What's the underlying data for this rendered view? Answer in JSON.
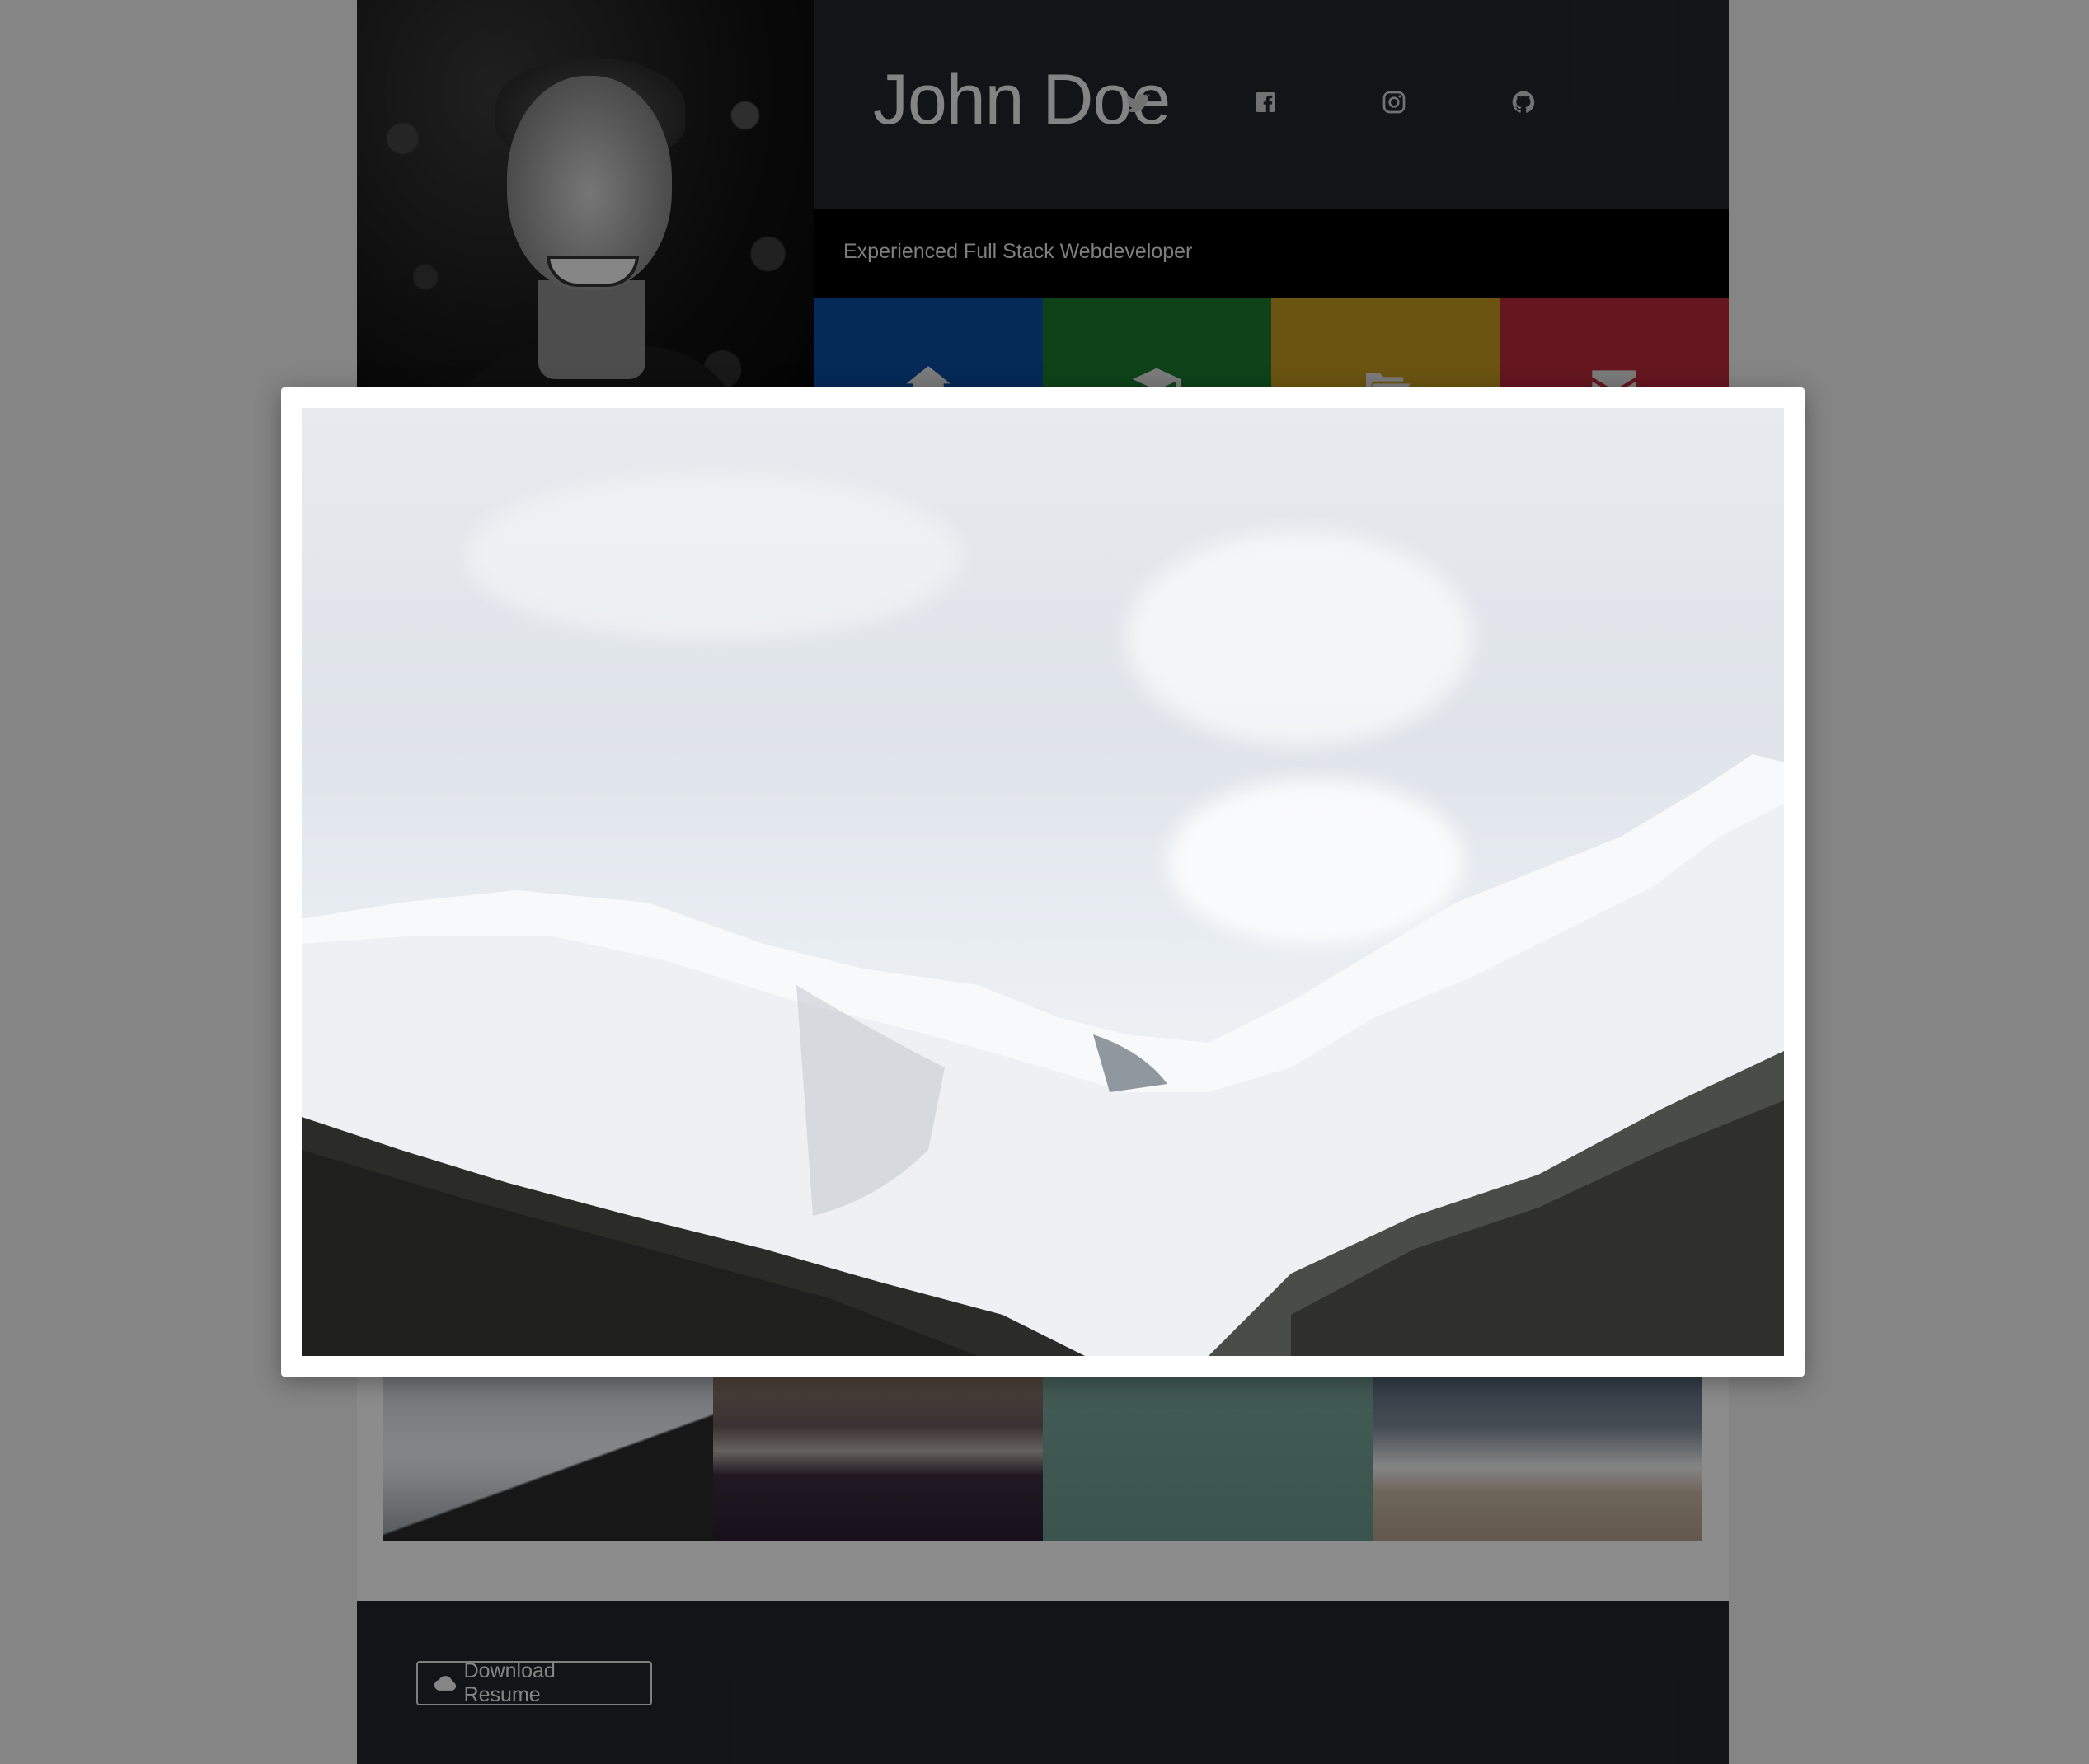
{
  "profile": {
    "name": "John Doe",
    "tagline": "Experienced Full Stack Webdeveloper"
  },
  "social": [
    "twitter-icon",
    "facebook-icon",
    "instagram-icon",
    "github-icon"
  ],
  "nav_tiles": [
    {
      "icon": "home-icon",
      "color": "#0a4ea1"
    },
    {
      "icon": "graduation-cap-icon",
      "color": "#1a7a2e"
    },
    {
      "icon": "folder-open-icon",
      "color": "#c49a1f"
    },
    {
      "icon": "envelope-icon",
      "color": "#b8283a"
    }
  ],
  "footer": {
    "download_label": "Download Resume"
  },
  "modal": {
    "image_alt": "snowy mountains"
  }
}
